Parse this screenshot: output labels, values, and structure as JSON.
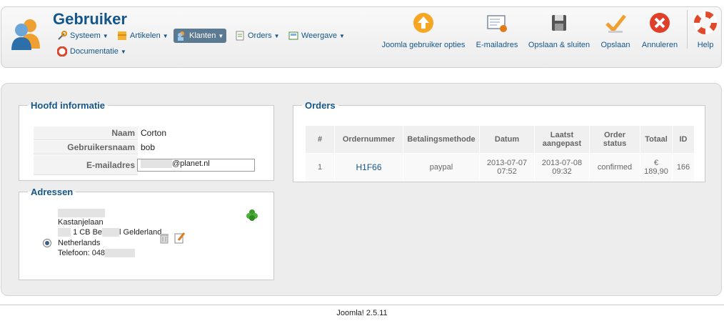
{
  "header": {
    "title": "Gebruiker",
    "menu": [
      {
        "label": "Systeem",
        "icon": "tools-icon"
      },
      {
        "label": "Artikelen",
        "icon": "articles-icon"
      },
      {
        "label": "Klanten",
        "icon": "customers-icon",
        "active": true
      },
      {
        "label": "Orders",
        "icon": "orders-icon"
      },
      {
        "label": "Weergave",
        "icon": "display-icon"
      },
      {
        "label": "Documentatie",
        "icon": "docs-icon"
      }
    ],
    "toolbar": {
      "options": "Joomla gebruiker opties",
      "email": "E-mailadres",
      "save_close": "Opslaan & sluiten",
      "save": "Opslaan",
      "cancel": "Annuleren",
      "help": "Help"
    }
  },
  "info": {
    "legend": "Hoofd informatie",
    "name_label": "Naam",
    "name_value": "Corton",
    "username_label": "Gebruikersnaam",
    "username_value": "bob",
    "email_label": "E-mailadres",
    "email_value": "@planet.nl"
  },
  "addresses": {
    "legend": "Adressen",
    "street": "Kastanjelaan",
    "postcode": "1 CB Be",
    "city": "l Gelderland",
    "country": "Netherlands",
    "phone": "Telefoon: 048"
  },
  "orders": {
    "legend": "Orders",
    "headers": [
      "#",
      "Ordernummer",
      "Betalingsmethode",
      "Datum",
      "Laatst aangepast",
      "Order status",
      "Totaal",
      "ID"
    ],
    "rows": [
      {
        "num": "1",
        "order_number": "H1F66",
        "payment": "paypal",
        "date": "2013-07-07 07:52",
        "modified": "2013-07-08 09:32",
        "status": "confirmed",
        "total": "€ 189,90",
        "id": "166"
      }
    ]
  },
  "footer": {
    "version": "Joomla! 2.5.11"
  },
  "colors": {
    "accent": "#14568a",
    "active_menu": "#5d7a93",
    "panel_bg": "#ededed"
  }
}
